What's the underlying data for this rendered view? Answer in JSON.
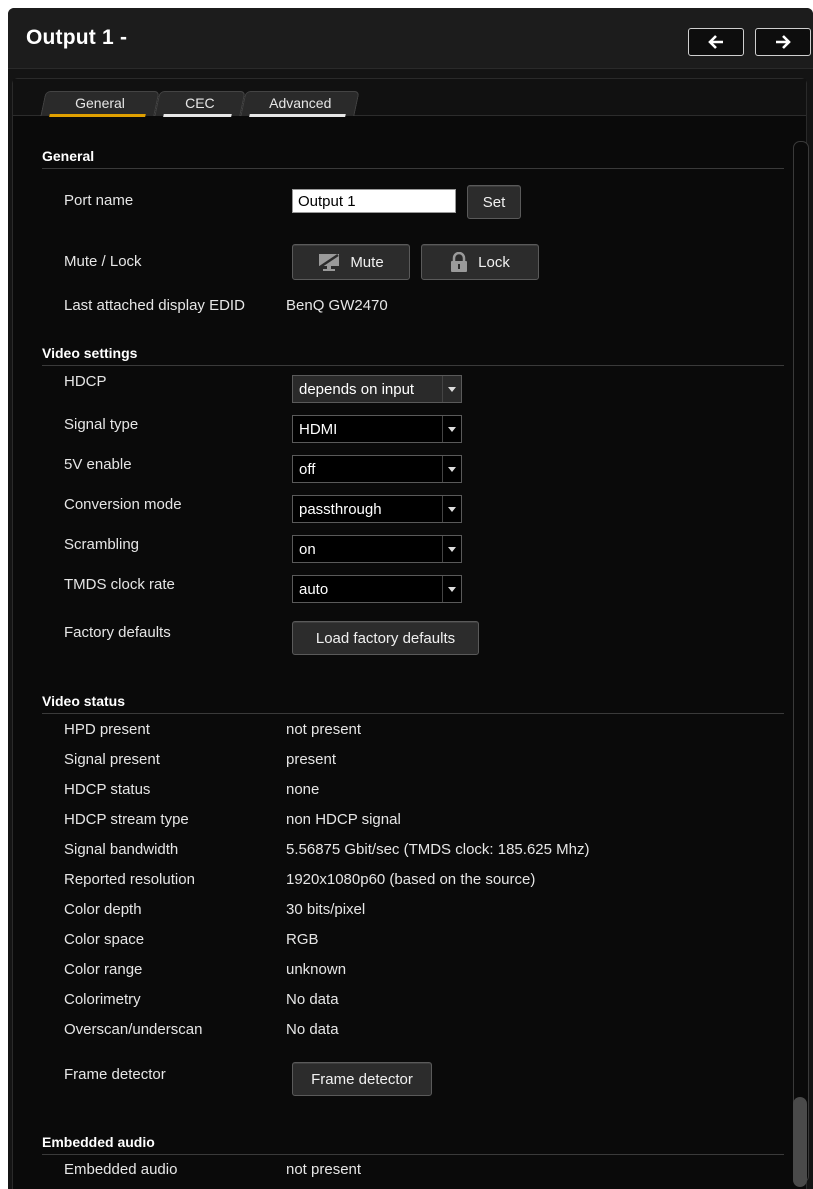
{
  "header": {
    "title": "Output 1 -"
  },
  "tabs": [
    {
      "label": "General",
      "underline": "#e0a000"
    },
    {
      "label": "CEC",
      "underline": "#e8e8e8"
    },
    {
      "label": "Advanced",
      "underline": "#e8e8e8"
    }
  ],
  "general": {
    "section_title": "General",
    "port_name_label": "Port name",
    "port_name_value": "Output 1",
    "set_label": "Set",
    "mute_lock_label": "Mute / Lock",
    "mute_label": "Mute",
    "lock_label": "Lock",
    "edid_label": "Last attached display EDID",
    "edid_value": "BenQ GW2470"
  },
  "video_settings": {
    "section_title": "Video settings",
    "hdcp_label": "HDCP",
    "hdcp_value": "depends on input",
    "signal_type_label": "Signal type",
    "signal_type_value": "HDMI",
    "fivev_label": "5V enable",
    "fivev_value": "off",
    "conversion_label": "Conversion mode",
    "conversion_value": "passthrough",
    "scrambling_label": "Scrambling",
    "scrambling_value": "on",
    "tmds_label": "TMDS clock rate",
    "tmds_value": "auto",
    "factory_label": "Factory defaults",
    "factory_button": "Load factory defaults"
  },
  "video_status": {
    "section_title": "Video status",
    "rows": [
      {
        "label": "HPD present",
        "value": "not present"
      },
      {
        "label": "Signal present",
        "value": "present"
      },
      {
        "label": "HDCP status",
        "value": "none"
      },
      {
        "label": "HDCP stream type",
        "value": "non HDCP signal"
      },
      {
        "label": "Signal bandwidth",
        "value": "5.56875 Gbit/sec (TMDS clock: 185.625 Mhz)"
      },
      {
        "label": "Reported resolution",
        "value": "1920x1080p60 (based on the source)"
      },
      {
        "label": "Color depth",
        "value": "30 bits/pixel"
      },
      {
        "label": "Color space",
        "value": "RGB"
      },
      {
        "label": "Color range",
        "value": "unknown"
      },
      {
        "label": "Colorimetry",
        "value": "No data"
      },
      {
        "label": "Overscan/underscan",
        "value": "No data"
      }
    ],
    "frame_label": "Frame detector",
    "frame_button": "Frame detector"
  },
  "embedded_audio": {
    "section_title": "Embedded audio",
    "label": "Embedded audio",
    "value": "not present"
  }
}
